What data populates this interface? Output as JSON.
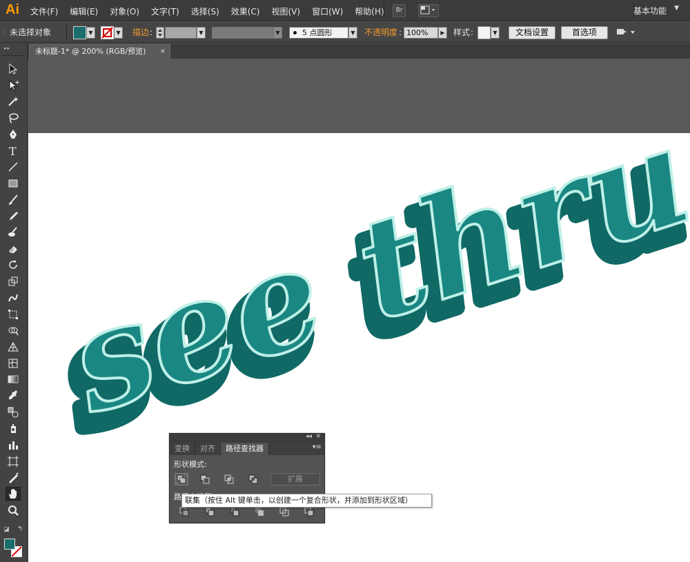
{
  "app": {
    "logo": "Ai",
    "workspace": "基本功能"
  },
  "menu": [
    "文件(F)",
    "编辑(E)",
    "对象(O)",
    "文字(T)",
    "选择(S)",
    "效果(C)",
    "视图(V)",
    "窗口(W)",
    "帮助(H)"
  ],
  "menubar_buttons": {
    "bridge": "Br"
  },
  "control_bar": {
    "selection_status": "未选择对象",
    "stroke_label": "描边",
    "brush_value": "5 点圆形",
    "opacity_label": "不透明度",
    "opacity_value": "100%",
    "style_label": "样式",
    "doc_setup_button": "文档设置",
    "preferences_button": "首选项"
  },
  "document_tab": {
    "title": "未标题-1* @ 200% (RGB/预览)",
    "close": "×"
  },
  "artwork": {
    "text": "see thru",
    "colors": {
      "face": "#1a8782",
      "side": "#106965",
      "outline": "#bff0e8"
    }
  },
  "colors": {
    "fill": "#1a6e6c",
    "accent": "#ff9a00"
  },
  "pathfinder_panel": {
    "tabs": [
      "变换",
      "对齐",
      "路径查找器"
    ],
    "active_tab": "路径查找器",
    "shape_modes_label": "形状模式:",
    "expand_button": "扩展",
    "pathfinders_label": "路径查找器:"
  },
  "tooltip": {
    "text": "联集（按住 Alt 键单击，以创建一个复合形状，并添加到形状区域）"
  },
  "toolbox": {
    "tools": [
      "selection-tool",
      "direct-selection-tool",
      "magic-wand-tool",
      "lasso-tool",
      "pen-tool",
      "type-tool",
      "line-tool",
      "rectangle-tool",
      "paintbrush-tool",
      "pencil-tool",
      "blob-brush-tool",
      "eraser-tool",
      "rotate-tool",
      "scale-tool",
      "warp-tool",
      "free-transform-tool",
      "shape-builder-tool",
      "perspective-grid-tool",
      "mesh-tool",
      "gradient-tool",
      "eyedropper-tool",
      "blend-tool",
      "symbol-sprayer-tool",
      "column-graph-tool",
      "artboard-tool",
      "slice-tool",
      "hand-tool",
      "zoom-tool"
    ],
    "active_tool": "hand-tool"
  }
}
